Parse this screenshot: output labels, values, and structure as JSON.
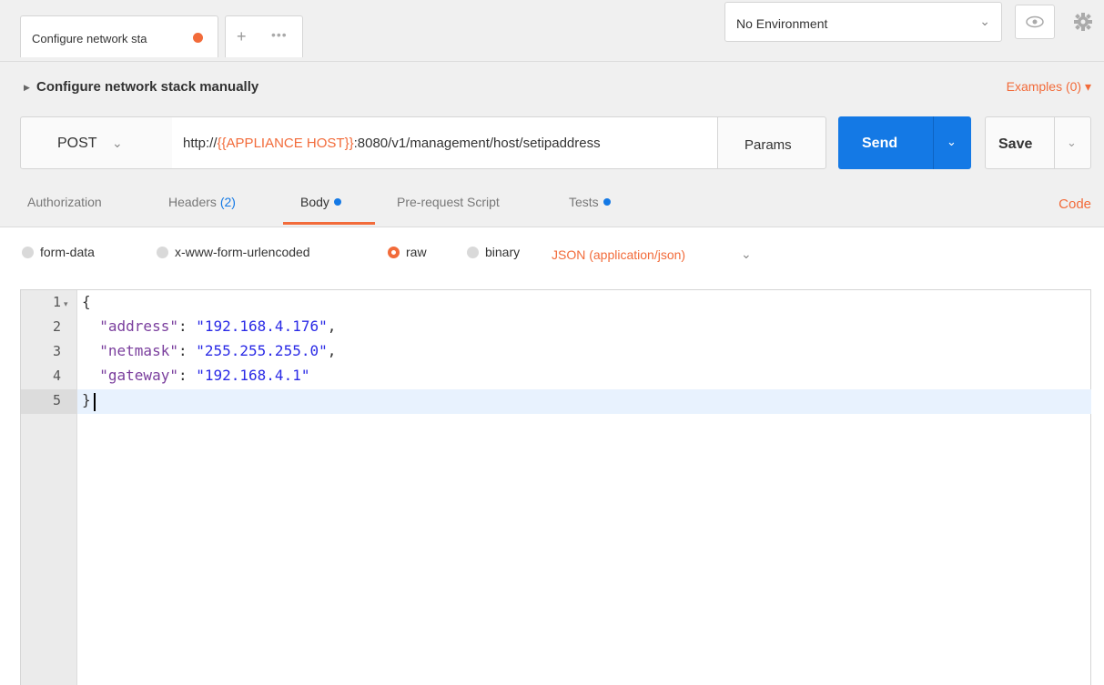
{
  "tabs": [
    {
      "label": "Configure network sta"
    }
  ],
  "tabbar": {
    "plus": "+",
    "more": "•••"
  },
  "environment": {
    "selected": "No Environment"
  },
  "request": {
    "title": "Configure network stack manually",
    "examples_label": "Examples (0)",
    "method": "POST",
    "url_prefix": "http://",
    "url_variable": "{{APPLIANCE HOST}}",
    "url_suffix": ":8080/v1/management/host/setipaddress",
    "params_label": "Params",
    "send_label": "Send",
    "save_label": "Save"
  },
  "request_tabs": {
    "authorization": "Authorization",
    "headers": "Headers",
    "headers_count": "(2)",
    "body": "Body",
    "prerequest": "Pre-request Script",
    "tests": "Tests",
    "code": "Code",
    "active": "Body"
  },
  "body_modes": {
    "form_data": "form-data",
    "urlencoded": "x-www-form-urlencoded",
    "raw": "raw",
    "binary": "binary",
    "selected": "raw",
    "content_type": "JSON (application/json)"
  },
  "editor": {
    "line_numbers": [
      "1",
      "2",
      "3",
      "4",
      "5"
    ],
    "current_line": "5",
    "open_brace": "{",
    "close_brace": "}",
    "fields": [
      {
        "key": "\"address\"",
        "value": "\"192.168.4.176\"",
        "trail": ","
      },
      {
        "key": "\"netmask\"",
        "value": "\"255.255.255.0\"",
        "trail": ","
      },
      {
        "key": "\"gateway\"",
        "value": "\"192.168.4.1\"",
        "trail": ""
      }
    ]
  },
  "colors": {
    "accent": "#f26b3a",
    "primary": "#1479e5"
  }
}
